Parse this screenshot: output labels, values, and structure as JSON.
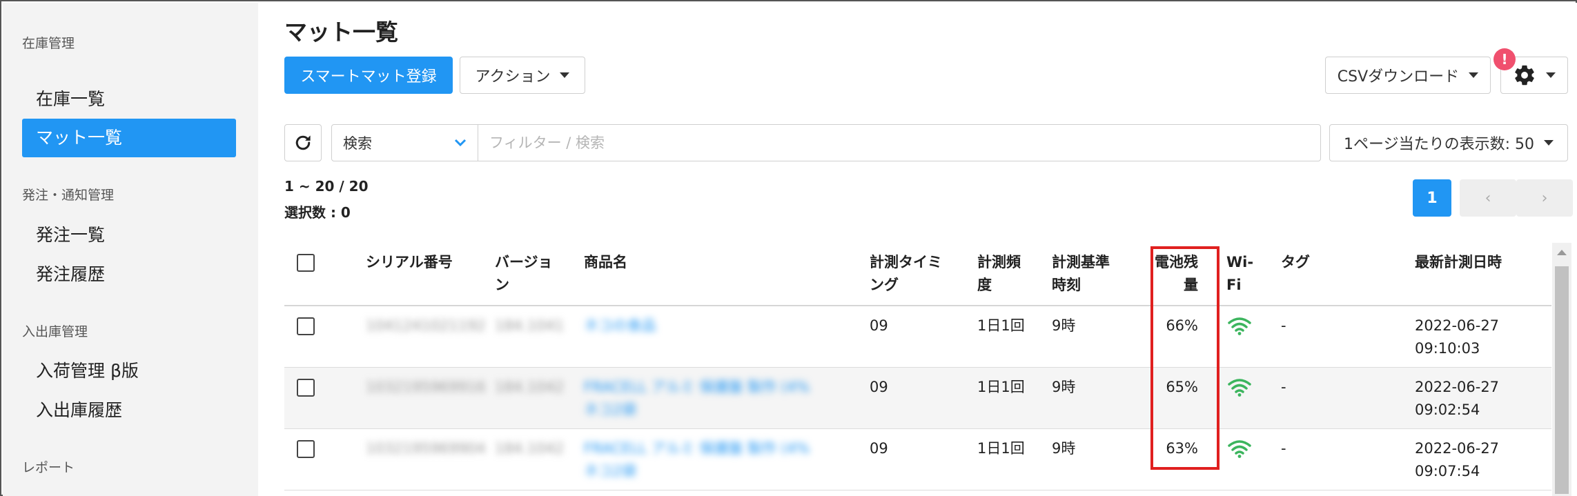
{
  "sidebar": {
    "sections": [
      {
        "label": "在庫管理",
        "items": [
          "在庫一覧",
          "マット一覧"
        ]
      },
      {
        "label": "発注・通知管理",
        "items": [
          "発注一覧",
          "発注履歴"
        ]
      },
      {
        "label": "入出庫管理",
        "items": [
          "入荷管理 β版",
          "入出庫履歴"
        ]
      },
      {
        "label": "レポート",
        "items": []
      }
    ],
    "active_item": "マット一覧"
  },
  "page": {
    "title": "マット一覧",
    "register_button": "スマートマット登録",
    "action_button": "アクション",
    "csv_button": "CSVダウンロード",
    "settings_badge": "!",
    "search_select": "検索",
    "search_placeholder": "フィルター / 検索",
    "per_page": "1ページ当たりの表示数: 50",
    "range": "1 ~ 20 / 20",
    "selected": "選択数 : 0",
    "pagination": {
      "current": "1",
      "prev": "‹",
      "next": "›"
    }
  },
  "table": {
    "columns": {
      "serial": "シリアル番号",
      "version": "バージョン",
      "product": "商品名",
      "timing": "計測タイミング",
      "frequency": "計測頻度",
      "base_time": "計測基準時刻",
      "battery": "電池残量",
      "wifi": "Wi-Fi",
      "tag": "タグ",
      "latest": "最新計測日時"
    },
    "rows": [
      {
        "serial": "1041241021192",
        "version": "184.1041",
        "product": "ネコの食品",
        "product_line2": "",
        "timing": "09",
        "frequency": "1日1回",
        "base_time": "9時",
        "battery": "66%",
        "tag": "-",
        "date": "2022-06-27",
        "time": "09:10:03"
      },
      {
        "serial": "1032195969916",
        "version": "184.1042",
        "product": "FRACELL アルミ 保護盤 製作 (4%",
        "product_line2": "ネコ2袋",
        "timing": "09",
        "frequency": "1日1回",
        "base_time": "9時",
        "battery": "65%",
        "tag": "-",
        "date": "2022-06-27",
        "time": "09:02:54"
      },
      {
        "serial": "1032195969904",
        "version": "184.1042",
        "product": "FRACELL アルミ 保護盤 製作 (4%",
        "product_line2": "ネコ2袋",
        "timing": "09",
        "frequency": "1日1回",
        "base_time": "9時",
        "battery": "63%",
        "tag": "-",
        "date": "2022-06-27",
        "time": "09:07:54"
      }
    ]
  },
  "colors": {
    "primary": "#2196f3",
    "highlight": "#e0201f",
    "wifi": "#3cb55e",
    "badge": "#f0506e"
  },
  "icons": [
    "refresh-icon",
    "chevron-down-icon",
    "gear-icon",
    "wifi-icon"
  ]
}
